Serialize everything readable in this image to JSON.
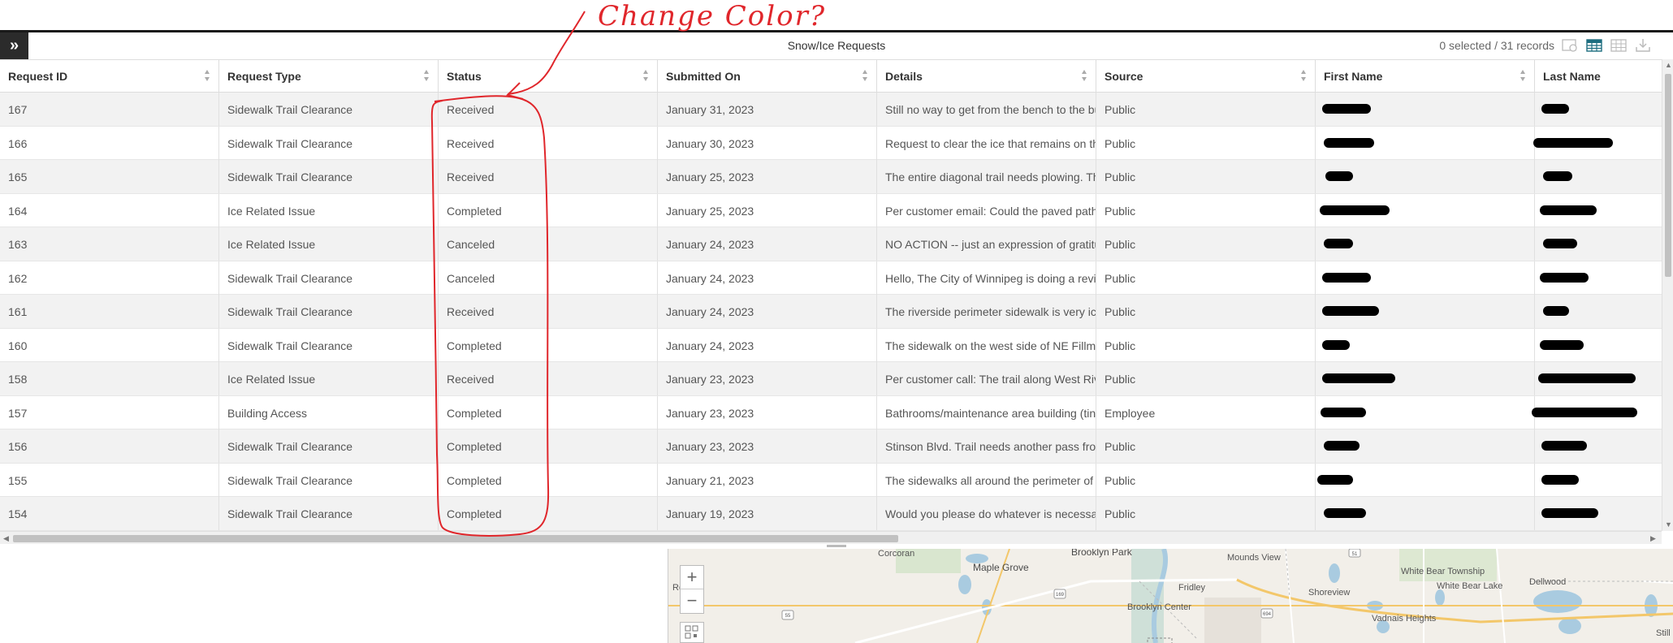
{
  "annotation": {
    "text": "Change Color?",
    "color": "#e0262b"
  },
  "toolbar": {
    "title": "Snow/Ice Requests",
    "records": "0 selected / 31 records",
    "icons": [
      "filter-by-extent-icon",
      "table-view-icon",
      "show-hide-columns-icon",
      "export-icon"
    ]
  },
  "columns": [
    "Request ID",
    "Request Type",
    "Status",
    "Submitted On",
    "Details",
    "Source",
    "First Name",
    "Last Name"
  ],
  "rows": [
    {
      "id": "167",
      "type": "Sidewalk Trail Clearance",
      "status": "Received",
      "date": "January 31, 2023",
      "details": "Still no way to get from the bench to the bu",
      "source": "Public"
    },
    {
      "id": "166",
      "type": "Sidewalk Trail Clearance",
      "status": "Received",
      "date": "January 30, 2023",
      "details": "Request to clear the ice that remains on the",
      "source": "Public"
    },
    {
      "id": "165",
      "type": "Sidewalk Trail Clearance",
      "status": "Received",
      "date": "January 25, 2023",
      "details": "The entire diagonal trail needs plowing. Th",
      "source": "Public"
    },
    {
      "id": "164",
      "type": "Ice Related Issue",
      "status": "Completed",
      "date": "January 25, 2023",
      "details": "Per customer email: Could the paved path",
      "source": "Public"
    },
    {
      "id": "163",
      "type": "Ice Related Issue",
      "status": "Canceled",
      "date": "January 24, 2023",
      "details": "NO ACTION -- just an expression of gratitu",
      "source": "Public"
    },
    {
      "id": "162",
      "type": "Sidewalk Trail Clearance",
      "status": "Canceled",
      "date": "January 24, 2023",
      "details": "Hello, The City of Winnipeg is doing a revie",
      "source": "Public"
    },
    {
      "id": "161",
      "type": "Sidewalk Trail Clearance",
      "status": "Received",
      "date": "January 24, 2023",
      "details": "The riverside perimeter sidewalk is very icy",
      "source": "Public"
    },
    {
      "id": "160",
      "type": "Sidewalk Trail Clearance",
      "status": "Completed",
      "date": "January 24, 2023",
      "details": "The sidewalk on the west side of NE Fillmo",
      "source": "Public"
    },
    {
      "id": "158",
      "type": "Ice Related Issue",
      "status": "Received",
      "date": "January 23, 2023",
      "details": "Per customer call: The trail along West Rive",
      "source": "Public"
    },
    {
      "id": "157",
      "type": "Building Access",
      "status": "Completed",
      "date": "January 23, 2023",
      "details": "Bathrooms/maintenance area building (tin",
      "source": "Employee"
    },
    {
      "id": "156",
      "type": "Sidewalk Trail Clearance",
      "status": "Completed",
      "date": "January 23, 2023",
      "details": "Stinson Blvd. Trail needs another pass from",
      "source": "Public"
    },
    {
      "id": "155",
      "type": "Sidewalk Trail Clearance",
      "status": "Completed",
      "date": "January 21, 2023",
      "details": "The sidewalks all around the perimeter of .",
      "source": "Public"
    },
    {
      "id": "154",
      "type": "Sidewalk Trail Clearance",
      "status": "Completed",
      "date": "January 19, 2023",
      "details": "Would you please do whatever is necessar",
      "source": "Public"
    }
  ],
  "map": {
    "labels": [
      "Corcoran",
      "Maple Grove",
      "Brooklyn Park",
      "Mounds View",
      "Fridley",
      "Shoreview",
      "White Bear Township",
      "White Bear Lake",
      "Dellwood",
      "Brooklyn Center",
      "Vadnais Heights",
      "Ro",
      "Still"
    ],
    "road_shields": [
      "169",
      "610",
      "55",
      "694",
      "51",
      "35"
    ]
  }
}
